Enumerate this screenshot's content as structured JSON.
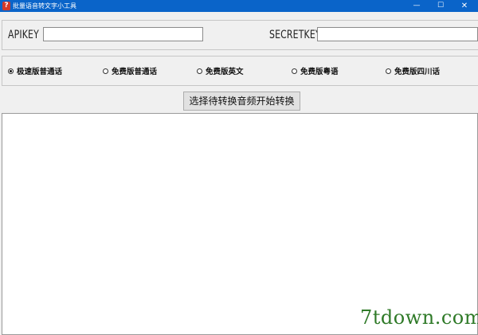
{
  "window": {
    "icon_glyph": "?",
    "title": "批量语音转文字小工具",
    "minimize_glyph": "—",
    "maximize_glyph": "☐",
    "close_glyph": "✕"
  },
  "keys": {
    "apikey_label": "APIKEY",
    "apikey_value": "",
    "secretkey_label": "SECRETKEY",
    "secretkey_value": ""
  },
  "modes": [
    {
      "label": "极速版普通话",
      "checked": true
    },
    {
      "label": "免费版普通话",
      "checked": false
    },
    {
      "label": "免费版英文",
      "checked": false
    },
    {
      "label": "免费版粤语",
      "checked": false
    },
    {
      "label": "免费版四川话",
      "checked": false
    }
  ],
  "convert_button_label": "选择待转换音频开始转换",
  "output_text": "",
  "watermark": "7tdown.com"
}
